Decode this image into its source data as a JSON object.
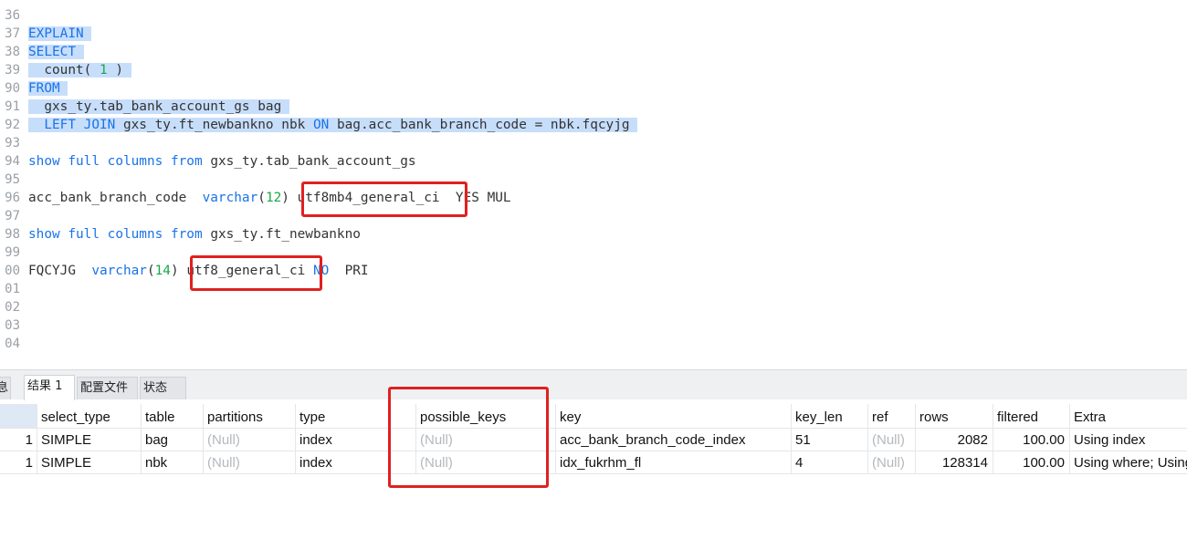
{
  "editor": {
    "gutter": [
      "36",
      "37",
      "38",
      "39",
      "90",
      "91",
      "92",
      "93",
      "94",
      "95",
      "96",
      "97",
      "98",
      "99",
      "00",
      "01",
      "02",
      "03",
      "04"
    ],
    "lines": [
      "",
      "EXPLAIN",
      "SELECT",
      "  count( 1 )",
      "FROM",
      "  gxs_ty.tab_bank_account_gs bag",
      "  LEFT JOIN gxs_ty.ft_newbankno nbk ON bag.acc_bank_branch_code = nbk.fqcyjg",
      "",
      "show full columns from gxs_ty.tab_bank_account_gs",
      "",
      "acc_bank_branch_code  varchar(12) utf8mb4_general_ci  YES MUL",
      "",
      "show full columns from gxs_ty.ft_newbankno",
      "",
      "FQCYJG  varchar(14) utf8_general_ci NO  PRI",
      "",
      "",
      "",
      ""
    ]
  },
  "colors": {
    "keyword": "#1a73e8",
    "number": "#15a84a",
    "selection": "#c7defb",
    "highlight_box": "#e02020"
  },
  "tabs": [
    "息",
    "结果 1",
    "配置文件",
    "状态"
  ],
  "active_tab": "结果 1",
  "results": {
    "columns": [
      "select_type",
      "table",
      "partitions",
      "type",
      "possible_keys",
      "key",
      "key_len",
      "ref",
      "rows",
      "filtered",
      "Extra"
    ],
    "rows": [
      [
        "1",
        "SIMPLE",
        "bag",
        "(Null)",
        "index",
        "(Null)",
        "acc_bank_branch_code_index",
        "51",
        "(Null)",
        "2082",
        "100.00",
        "Using index"
      ],
      [
        "1",
        "SIMPLE",
        "nbk",
        "(Null)",
        "index",
        "(Null)",
        "idx_fukrhm_fl",
        "4",
        "(Null)",
        "128314",
        "100.00",
        "Using where; Using join buffer (Block Nested Loop)"
      ]
    ]
  }
}
